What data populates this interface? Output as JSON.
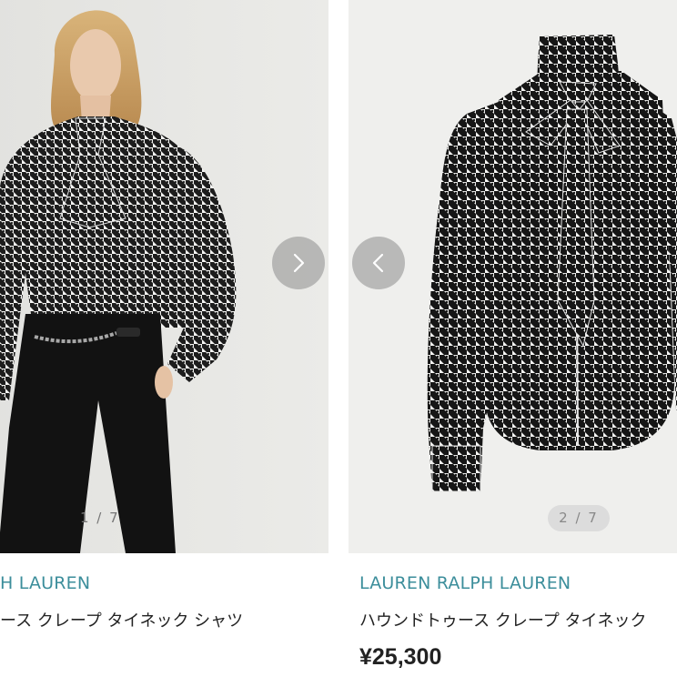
{
  "products": [
    {
      "brand": "H LAUREN",
      "name": "ース クレープ タイネック シャツ",
      "image_counter": "1 / 7"
    },
    {
      "brand": "LAUREN RALPH LAUREN",
      "name": "ハウンドトゥース クレープ タイネック",
      "price": "¥25,300",
      "image_counter": "2 / 7"
    }
  ],
  "icons": {
    "next": "chevron-right-icon",
    "prev": "chevron-left-icon"
  },
  "colors": {
    "brand_text": "#3c8e9b",
    "photo_bg": "#efefed",
    "nav_button": "#8c8c8c"
  }
}
